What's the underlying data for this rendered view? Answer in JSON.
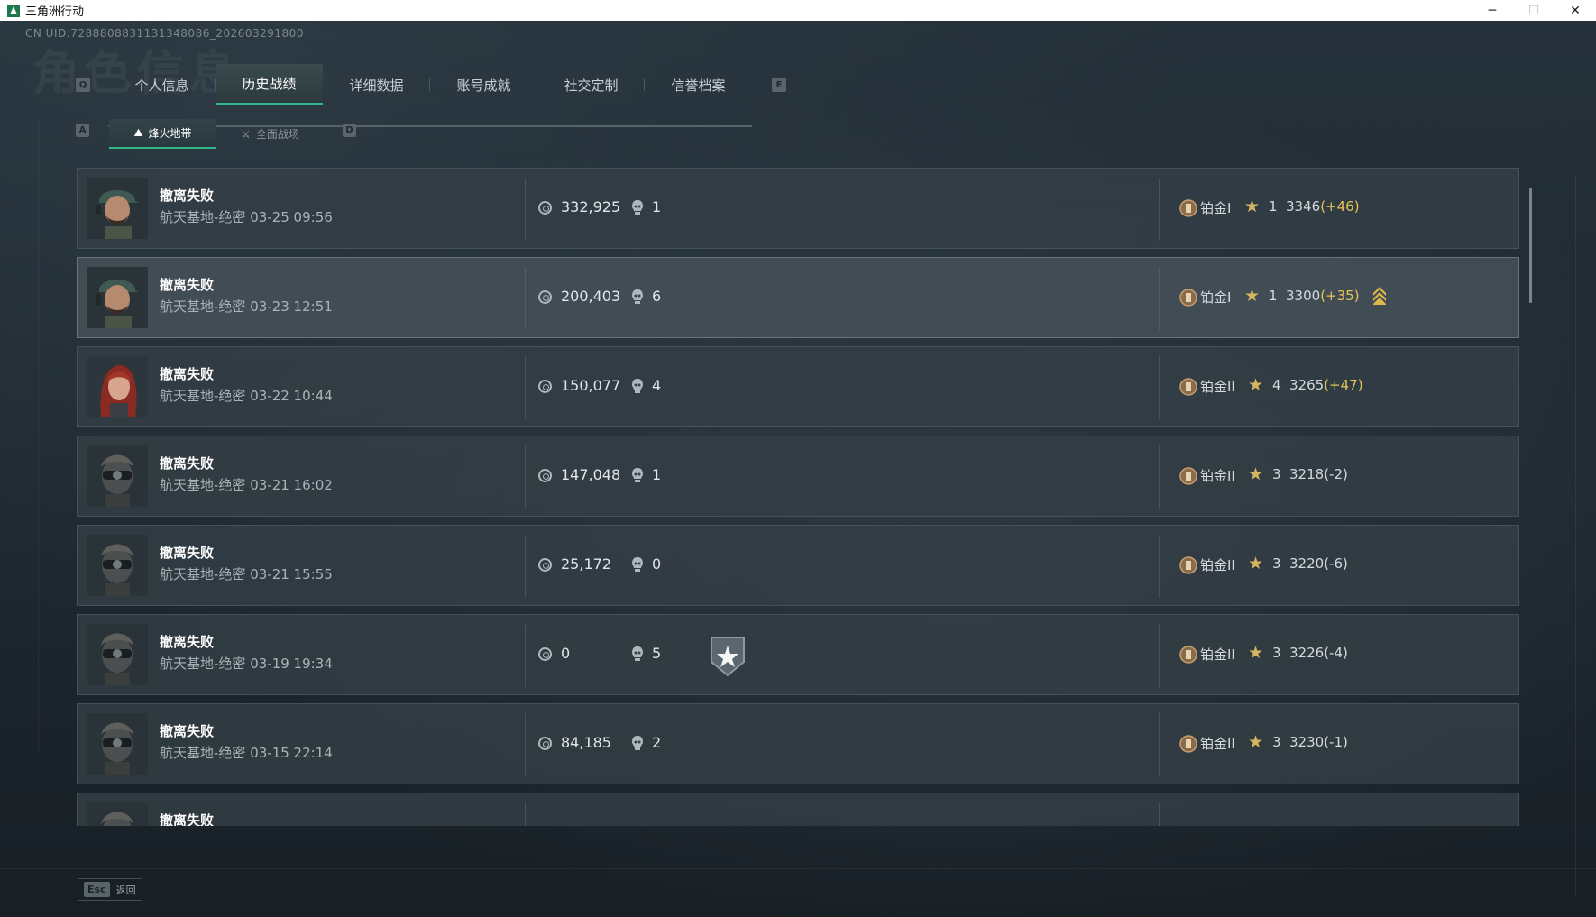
{
  "window": {
    "title": "三角洲行动",
    "controls": [
      "─",
      "☐",
      "✕"
    ]
  },
  "header": {
    "uid": "CN UID:7288808831131348086_202603291800",
    "watermark": "角色信息"
  },
  "tabs": {
    "left_key": "Q",
    "right_key": "E",
    "items": [
      {
        "label": "个人信息",
        "active": false
      },
      {
        "label": "历史战绩",
        "active": true
      },
      {
        "label": "详细数据",
        "active": false
      },
      {
        "label": "账号成就",
        "active": false
      },
      {
        "label": "社交定制",
        "active": false
      },
      {
        "label": "信誉档案",
        "active": false
      }
    ]
  },
  "subtabs": {
    "left_key": "A",
    "right_key": "D",
    "items": [
      {
        "label": "烽火地带",
        "icon": "⛰",
        "active": true
      },
      {
        "label": "全面战场",
        "icon": "⚔",
        "active": false
      }
    ]
  },
  "matches": [
    {
      "status": "撤离失败",
      "map": "航天基地-绝密",
      "time": "03-25 09:56",
      "value": "332,925",
      "kills": "1",
      "rank": "铂金I",
      "stars": "1",
      "score": "3346",
      "delta": "(+46)",
      "delta_type": "pos",
      "avatar": "soldier-cap",
      "badge": false,
      "rankup": false
    },
    {
      "status": "撤离失败",
      "map": "航天基地-绝密",
      "time": "03-23 12:51",
      "value": "200,403",
      "kills": "6",
      "rank": "铂金I",
      "stars": "1",
      "score": "3300",
      "delta": "(+35)",
      "delta_type": "pos",
      "avatar": "soldier-cap",
      "badge": false,
      "rankup": true
    },
    {
      "status": "撤离失败",
      "map": "航天基地-绝密",
      "time": "03-22 10:44",
      "value": "150,077",
      "kills": "4",
      "rank": "铂金II",
      "stars": "4",
      "score": "3265",
      "delta": "(+47)",
      "delta_type": "pos",
      "avatar": "red-hair",
      "badge": false,
      "rankup": false
    },
    {
      "status": "撤离失败",
      "map": "航天基地-绝密",
      "time": "03-21 16:02",
      "value": "147,048",
      "kills": "1",
      "rank": "铂金II",
      "stars": "3",
      "score": "3218",
      "delta": "(-2)",
      "delta_type": "neg",
      "avatar": "masked",
      "badge": false,
      "rankup": false
    },
    {
      "status": "撤离失败",
      "map": "航天基地-绝密",
      "time": "03-21 15:55",
      "value": "25,172",
      "kills": "0",
      "rank": "铂金II",
      "stars": "3",
      "score": "3220",
      "delta": "(-6)",
      "delta_type": "neg",
      "avatar": "masked",
      "badge": false,
      "rankup": false
    },
    {
      "status": "撤离失败",
      "map": "航天基地-绝密",
      "time": "03-19 19:34",
      "value": "0",
      "kills": "5",
      "rank": "铂金II",
      "stars": "3",
      "score": "3226",
      "delta": "(-4)",
      "delta_type": "neg",
      "avatar": "masked",
      "badge": true,
      "rankup": false
    },
    {
      "status": "撤离失败",
      "map": "航天基地-绝密",
      "time": "03-15 22:14",
      "value": "84,185",
      "kills": "2",
      "rank": "铂金II",
      "stars": "3",
      "score": "3230",
      "delta": "(-1)",
      "delta_type": "neg",
      "avatar": "masked",
      "badge": false,
      "rankup": false
    },
    {
      "status": "撤离失败",
      "map": "",
      "time": "",
      "value": "",
      "kills": "",
      "rank": "",
      "stars": "",
      "score": "",
      "delta": "",
      "delta_type": "neg",
      "avatar": "masked",
      "badge": false,
      "rankup": false
    }
  ],
  "footer": {
    "esc_key": "Esc",
    "esc_label": "返回"
  },
  "colors": {
    "accent": "#2fb68a",
    "gold": "#e7c356",
    "background": "#1b2329"
  }
}
